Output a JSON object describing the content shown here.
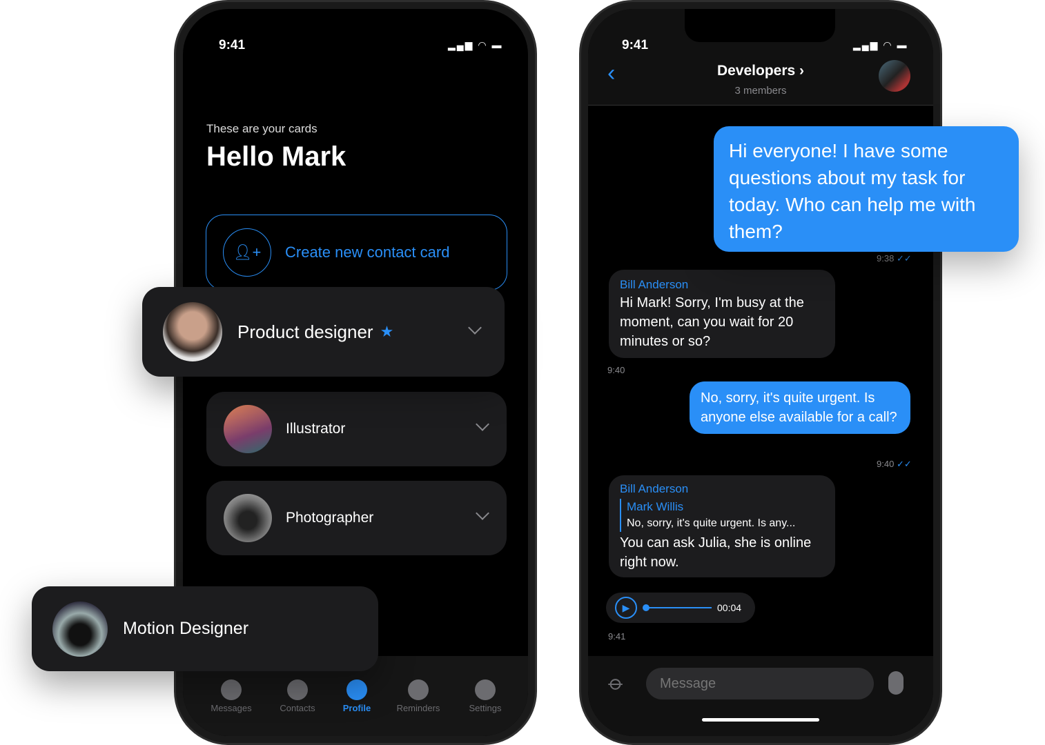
{
  "left_phone": {
    "status": {
      "time": "9:41"
    },
    "subtitle": "These are your cards",
    "title": "Hello Mark",
    "create_button": "Create new contact card",
    "cards": [
      {
        "label": "Product designer",
        "starred": true
      },
      {
        "label": "Illustrator"
      },
      {
        "label": "Photographer"
      },
      {
        "label": "Motion Designer"
      }
    ],
    "tabs": [
      {
        "label": "Messages",
        "icon": "chat-bubble-icon"
      },
      {
        "label": "Contacts",
        "icon": "contacts-icon"
      },
      {
        "label": "Profile",
        "icon": "person-icon",
        "active": true
      },
      {
        "label": "Reminders",
        "icon": "bell-icon"
      },
      {
        "label": "Settings",
        "icon": "gear-icon"
      }
    ]
  },
  "right_phone": {
    "status": {
      "time": "9:41"
    },
    "chat_title": "Developers",
    "chat_subtitle": "3 members",
    "messages": [
      {
        "dir": "out",
        "text": "Hi everyone! I have some questions about my task for today. Who can help me with them?",
        "time": "9:38"
      },
      {
        "dir": "in",
        "sender": "Bill Anderson",
        "text": "Hi Mark! Sorry, I'm busy at the moment, can you wait for 20 minutes or so?",
        "time": "9:40"
      },
      {
        "dir": "out",
        "text": "No, sorry, it's quite urgent. Is anyone else available for a call?",
        "time": "9:40"
      },
      {
        "dir": "in",
        "sender": "Bill Anderson",
        "reply_name": "Mark Willis",
        "reply_text": "No, sorry, it's quite urgent. Is any...",
        "text": "You can ask Julia, she is online right now.",
        "time": ""
      },
      {
        "dir": "in",
        "voice_duration": "00:04",
        "time": "9:41"
      }
    ],
    "input_placeholder": "Message"
  },
  "colors": {
    "accent": "#2a8ff7",
    "card": "#1c1c1e",
    "screen": "#000000"
  }
}
